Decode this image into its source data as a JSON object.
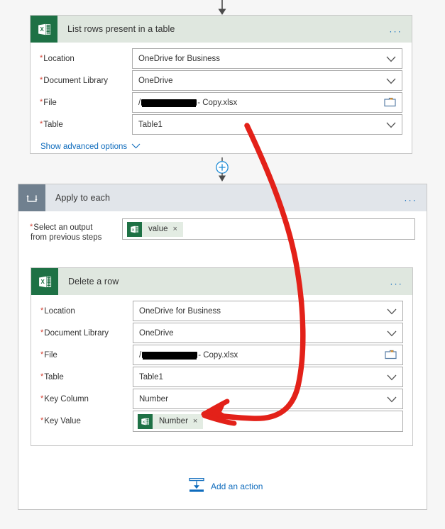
{
  "theme": {
    "page_bg": "#f6f6f6",
    "excel_green": "#1e7145",
    "card_header_green": "#dfe7df",
    "loop_header_blue_grey": "#e1e5ea",
    "loop_icon_tile": "#70808f",
    "link_blue": "#0f6cbd",
    "required_red": "#d23f31",
    "annotation_red": "#e32119",
    "token_bg": "#e3ece3",
    "border_grey": "#c8c8c8"
  },
  "connectors": {
    "top_arrow": "down-arrow-icon",
    "insert_button": "plus-circle-icon",
    "mid_arrow": "down-arrow-icon"
  },
  "list_rows_card": {
    "icon": "excel-icon",
    "title": "List rows present in a table",
    "more_menu": "...",
    "fields": [
      {
        "label": "Location",
        "required": true,
        "value": "OneDrive for Business",
        "control": "dropdown"
      },
      {
        "label": "Document Library",
        "required": true,
        "value": "OneDrive",
        "control": "dropdown"
      },
      {
        "label": "File",
        "required": true,
        "value": " - Copy.xlsx",
        "redacted": true,
        "control": "file-picker"
      },
      {
        "label": "Table",
        "required": true,
        "value": "Table1",
        "control": "dropdown"
      }
    ],
    "advanced_link": "Show advanced options"
  },
  "apply_to_each_card": {
    "icon": "loop-icon",
    "title": "Apply to each",
    "more_menu": "...",
    "select_output": {
      "label_line1": "Select an output",
      "label_line2": "from previous steps",
      "required": true,
      "token": {
        "icon": "excel-icon",
        "text": "value",
        "remove": "×"
      }
    },
    "delete_row_card": {
      "icon": "excel-icon",
      "title": "Delete a row",
      "more_menu": "...",
      "fields": [
        {
          "label": "Location",
          "required": true,
          "value": "OneDrive for Business",
          "control": "dropdown"
        },
        {
          "label": "Document Library",
          "required": true,
          "value": "OneDrive",
          "control": "dropdown"
        },
        {
          "label": "File",
          "required": true,
          "value": " - Copy.xlsx",
          "redacted": true,
          "control": "file-picker"
        },
        {
          "label": "Table",
          "required": true,
          "value": "Table1",
          "control": "dropdown"
        },
        {
          "label": "Key Column",
          "required": true,
          "value": "Number",
          "control": "dropdown"
        },
        {
          "label": "Key Value",
          "required": true,
          "value": "",
          "control": "token",
          "token": {
            "icon": "excel-icon",
            "text": "Number",
            "remove": "×"
          }
        }
      ]
    },
    "add_action": {
      "icon": "add-action-icon",
      "label": "Add an action"
    }
  },
  "annotation": {
    "type": "hand-drawn-arrow",
    "color": "#e32119",
    "points_from": "Table field area of List rows card",
    "points_to": "Key Value token of Delete a row card"
  }
}
